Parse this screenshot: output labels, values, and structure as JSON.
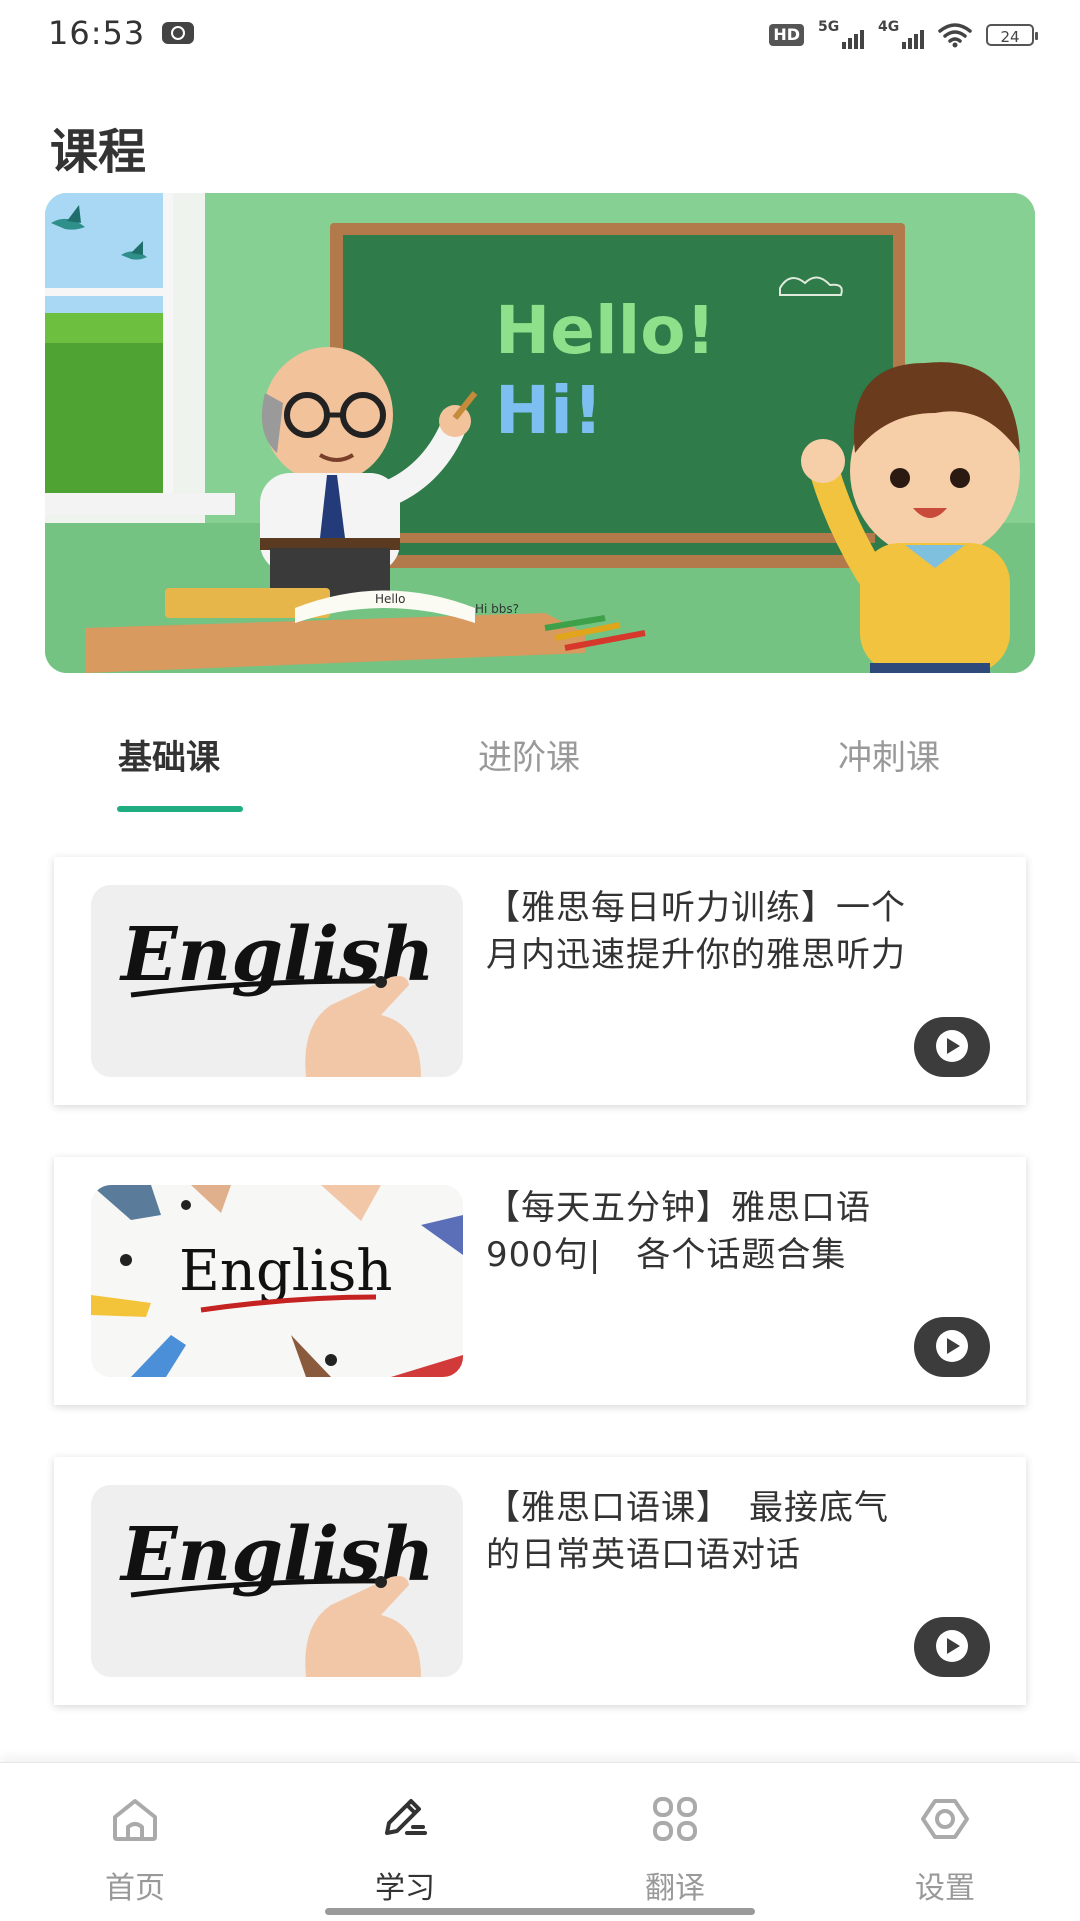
{
  "status_bar": {
    "time": "16:53",
    "hd_label": "HD",
    "network_1": "5G",
    "network_2": "4G",
    "battery": "24"
  },
  "page": {
    "title": "课程"
  },
  "banner": {
    "board_line_1": "Hello!",
    "board_line_2": "Hi!",
    "book_text_1": "Hello",
    "book_text_2": "Hi bbs?"
  },
  "tabs": [
    {
      "label": "基础课",
      "active": true
    },
    {
      "label": "进阶课",
      "active": false
    },
    {
      "label": "冲刺课",
      "active": false
    }
  ],
  "courses": [
    {
      "title_line_1": "【雅思每日听力训练】一个",
      "title_line_2": "月内迅速提升你的雅思听力",
      "thumb_text": "English",
      "thumb_style": "hand-writing"
    },
    {
      "title_line_1": "【每天五分钟】雅思口语",
      "title_line_2": "900句|　各个话题合集",
      "thumb_text": "English",
      "thumb_style": "hands-around-table"
    },
    {
      "title_line_1": "【雅思口语课】　最接底气",
      "title_line_2": "的日常英语口语对话",
      "thumb_text": "English",
      "thumb_style": "hand-writing"
    }
  ],
  "bottom_nav": [
    {
      "label": "首页",
      "icon": "home-icon",
      "active": false
    },
    {
      "label": "学习",
      "icon": "pen-icon",
      "active": true
    },
    {
      "label": "翻译",
      "icon": "grid-icon",
      "active": false
    },
    {
      "label": "设置",
      "icon": "settings-icon",
      "active": false
    }
  ],
  "colors": {
    "accent": "#1fae82",
    "tab_inactive": "#999999",
    "text_primary": "#333333",
    "play_button": "#3c3c3c"
  }
}
